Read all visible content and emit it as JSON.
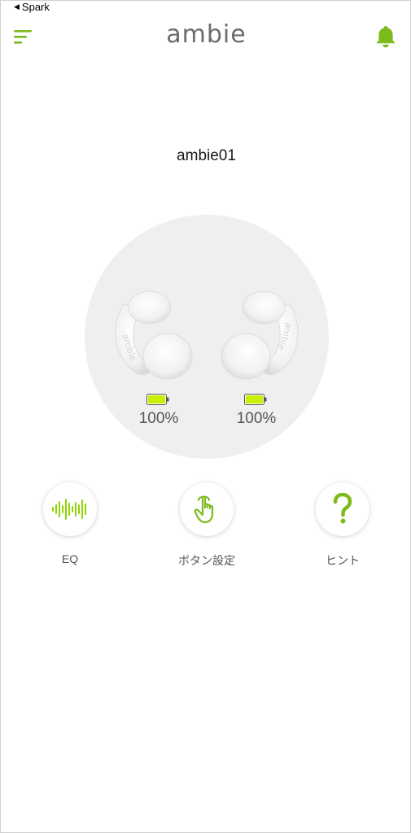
{
  "status_bar": {
    "back_app": "Spark"
  },
  "header": {
    "title": "ambie"
  },
  "device": {
    "name": "ambie01",
    "left": {
      "battery_level": 1.0,
      "battery_text": "100%"
    },
    "right": {
      "battery_level": 1.0,
      "battery_text": "100%"
    }
  },
  "actions": [
    {
      "label": "EQ",
      "icon": "waveform-icon"
    },
    {
      "label": "ボタン設定",
      "icon": "tap-hand-icon"
    },
    {
      "label": "ヒント",
      "icon": "question-mark-icon"
    }
  ],
  "colors": {
    "accent": "#7dbb1d",
    "battery_fill": "#c8f000",
    "circle_bg": "#efefef"
  }
}
